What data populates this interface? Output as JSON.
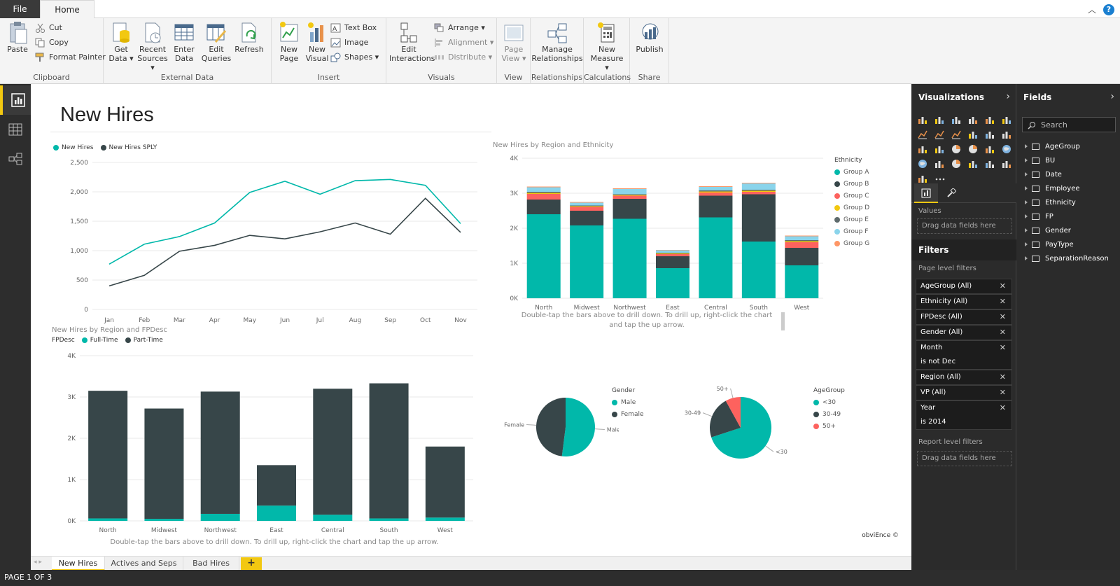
{
  "ribbon_tabs": {
    "file": "File",
    "home": "Home"
  },
  "ribbon": {
    "clipboard": {
      "label": "Clipboard",
      "paste": "Paste",
      "cut": "Cut",
      "copy": "Copy",
      "format_painter": "Format Painter"
    },
    "external_data": {
      "label": "External Data",
      "get_data": "Get Data ▾",
      "recent_sources": "Recent Sources ▾",
      "enter_data": "Enter Data",
      "edit_queries": "Edit Queries",
      "refresh": "Refresh"
    },
    "insert": {
      "label": "Insert",
      "new_page": "New Page",
      "new_visual": "New Visual",
      "text_box": "Text Box",
      "image": "Image",
      "shapes": "Shapes ▾"
    },
    "visuals": {
      "label": "Visuals",
      "edit_interactions": "Edit Interactions",
      "arrange": "Arrange ▾",
      "alignment": "Alignment ▾",
      "distribute": "Distribute ▾"
    },
    "view": {
      "label": "View",
      "page_view": "Page View ▾"
    },
    "relationships": {
      "label": "Relationships",
      "manage": "Manage Relationships"
    },
    "calculations": {
      "label": "Calculations",
      "new_measure": "New Measure ▾"
    },
    "share": {
      "label": "Share",
      "publish": "Publish"
    }
  },
  "page": {
    "title": "New Hires",
    "watermark": "obviEnce ©"
  },
  "line_chart": {
    "legend": [
      "New Hires",
      "New Hires SPLY"
    ]
  },
  "bar_eth": {
    "title": "New Hires by Region and Ethnicity",
    "legend_title": "Ethnicity",
    "drill_note": "Double-tap the bars above to drill down. To drill up, right-click the chart and tap the up arrow."
  },
  "bar_fp": {
    "title": "New Hires by Region and FPDesc",
    "legend_title": "FPDesc",
    "drill_note": "Double-tap the bars above to drill down. To drill up, right-click the chart and tap the up arrow."
  },
  "pie_gender": {
    "legend_title": "Gender"
  },
  "pie_age": {
    "legend_title": "AgeGroup"
  },
  "chart_data": [
    {
      "type": "line",
      "x": [
        "Jan",
        "Feb",
        "Mar",
        "Apr",
        "May",
        "Jun",
        "Jul",
        "Aug",
        "Sep",
        "Oct",
        "Nov"
      ],
      "series": [
        {
          "name": "New Hires",
          "color": "#01B8AA",
          "values": [
            770,
            1110,
            1240,
            1470,
            1990,
            2180,
            1960,
            2190,
            2210,
            2110,
            1460
          ]
        },
        {
          "name": "New Hires SPLY",
          "color": "#374649",
          "values": [
            400,
            580,
            990,
            1090,
            1260,
            1200,
            1320,
            1470,
            1280,
            1890,
            1310
          ]
        }
      ],
      "yticks": [
        "0",
        "500",
        "1,000",
        "1,500",
        "2,000",
        "2,500"
      ],
      "ylim": [
        0,
        2500
      ]
    },
    {
      "type": "bar",
      "stacked": true,
      "title": "New Hires by Region and Ethnicity",
      "categories": [
        "North",
        "Midwest",
        "Northwest",
        "East",
        "Central",
        "South",
        "West"
      ],
      "series": [
        {
          "name": "Group A",
          "color": "#01B8AA",
          "values": [
            2400,
            2080,
            2270,
            860,
            2310,
            1620,
            940
          ]
        },
        {
          "name": "Group B",
          "color": "#374649",
          "values": [
            420,
            420,
            570,
            340,
            620,
            1350,
            500
          ]
        },
        {
          "name": "Group C",
          "color": "#FD625E",
          "values": [
            160,
            110,
            90,
            60,
            90,
            70,
            160
          ]
        },
        {
          "name": "Group D",
          "color": "#F2C80F",
          "values": [
            30,
            20,
            20,
            20,
            30,
            30,
            30
          ]
        },
        {
          "name": "Group E",
          "color": "#5F6B6D",
          "values": [
            30,
            20,
            20,
            20,
            30,
            30,
            30
          ]
        },
        {
          "name": "Group F",
          "color": "#8AD4EB",
          "values": [
            130,
            80,
            150,
            70,
            100,
            180,
            110
          ]
        },
        {
          "name": "Group G",
          "color": "#FE9666",
          "values": [
            20,
            20,
            20,
            10,
            20,
            20,
            20
          ]
        }
      ],
      "yticks": [
        "0K",
        "1K",
        "2K",
        "3K",
        "4K"
      ],
      "ylim": [
        0,
        4000
      ]
    },
    {
      "type": "bar",
      "stacked": true,
      "title": "New Hires by Region and FPDesc",
      "categories": [
        "North",
        "Midwest",
        "Northwest",
        "East",
        "Central",
        "South",
        "West"
      ],
      "series": [
        {
          "name": "Full-Time",
          "color": "#01B8AA",
          "values": [
            60,
            50,
            170,
            370,
            150,
            60,
            80
          ]
        },
        {
          "name": "Part-Time",
          "color": "#374649",
          "values": [
            3090,
            2670,
            2960,
            980,
            3050,
            3270,
            1720
          ]
        }
      ],
      "yticks": [
        "0K",
        "1K",
        "2K",
        "3K",
        "4K"
      ],
      "ylim": [
        0,
        4000
      ]
    },
    {
      "type": "pie",
      "legend_title": "Gender",
      "slices": [
        {
          "name": "Male",
          "color": "#01B8AA",
          "value": 52
        },
        {
          "name": "Female",
          "color": "#374649",
          "value": 48
        }
      ]
    },
    {
      "type": "pie",
      "legend_title": "AgeGroup",
      "slices": [
        {
          "name": "<30",
          "color": "#01B8AA",
          "value": 70
        },
        {
          "name": "30-49",
          "color": "#374649",
          "value": 22
        },
        {
          "name": "50+",
          "color": "#FD625E",
          "value": 8
        }
      ]
    }
  ],
  "pages": {
    "tabs": [
      "New Hires",
      "Actives and Seps",
      "Bad Hires"
    ],
    "add": "+",
    "status": "PAGE 1 OF 3"
  },
  "viz_pane": {
    "title": "Visualizations",
    "values_label": "Values",
    "drop_hint": "Drag data fields here",
    "filters_title": "Filters",
    "page_level": "Page level filters",
    "report_level": "Report level filters",
    "report_drop_hint": "Drag data fields here",
    "filters": [
      {
        "name": "AgeGroup (All)"
      },
      {
        "name": "Ethnicity (All)"
      },
      {
        "name": "FPDesc (All)"
      },
      {
        "name": "Gender (All)"
      },
      {
        "name": "Month",
        "sub": "is not Dec"
      },
      {
        "name": "Region (All)"
      },
      {
        "name": "VP (All)"
      },
      {
        "name": "Year",
        "sub": "is 2014"
      }
    ]
  },
  "fields_pane": {
    "title": "Fields",
    "search_placeholder": "Search",
    "fields": [
      "AgeGroup",
      "BU",
      "Date",
      "Employee",
      "Ethnicity",
      "FP",
      "Gender",
      "PayType",
      "SeparationReason"
    ]
  }
}
